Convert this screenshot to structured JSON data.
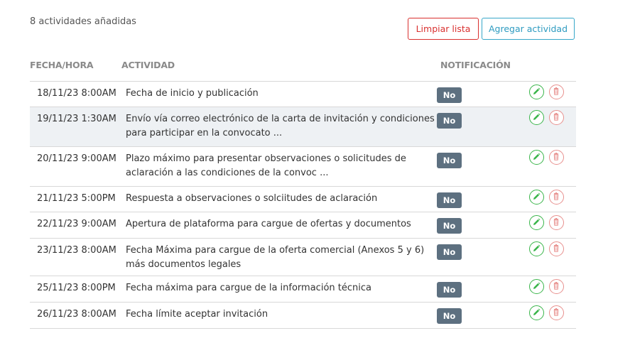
{
  "summary": {
    "count_label": "8 actividades añadidas"
  },
  "toolbar": {
    "clear_label": "Limpiar lista",
    "add_label": "Agregar actividad"
  },
  "table": {
    "headers": {
      "date": "FECHA/HORA",
      "activity": "ACTIVIDAD",
      "notification": "NOTIFICACIÓN"
    },
    "rows": [
      {
        "date": "18/11/23 8:00AM",
        "activity": "Fecha de inicio y publicación",
        "notification": "No"
      },
      {
        "date": "19/11/23 1:30AM",
        "activity": "Envío vía correo electrónico de la carta de invitación y condiciones para participar en la convocato ...",
        "notification": "No"
      },
      {
        "date": "20/11/23 9:00AM",
        "activity": "Plazo máximo para presentar observaciones o solicitudes de aclaración a las condiciones de la convoc ...",
        "notification": "No"
      },
      {
        "date": "21/11/23 5:00PM",
        "activity": "Respuesta a observaciones o solciitudes de aclaración",
        "notification": "No"
      },
      {
        "date": "22/11/23 9:00AM",
        "activity": "Apertura de plataforma para cargue de ofertas y documentos",
        "notification": "No"
      },
      {
        "date": "23/11/23 8:00AM",
        "activity": "Fecha Máxima para cargue de la oferta comercial (Anexos 5 y 6) más documentos legales",
        "notification": "No"
      },
      {
        "date": "25/11/23 8:00PM",
        "activity": "Fecha máxima para cargue de la información técnica",
        "notification": "No"
      },
      {
        "date": "26/11/23 8:00AM",
        "activity": "Fecha límite aceptar invitación",
        "notification": "No"
      }
    ]
  },
  "icons": {
    "edit": "pencil-icon",
    "delete": "trash-icon"
  },
  "colors": {
    "clear_button": "#d9302f",
    "add_button": "#37a7c9",
    "badge": "#5d7080",
    "edit_icon": "#3ab54a",
    "delete_icon": "#e8908e",
    "alt_row": "#eef1f4"
  }
}
